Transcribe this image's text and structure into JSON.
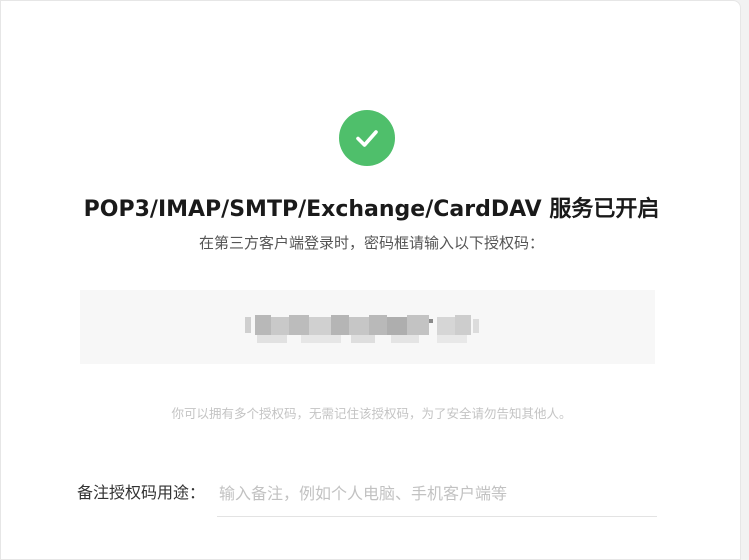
{
  "dialog": {
    "title": "POP3/IMAP/SMTP/Exchange/CardDAV 服务已开启",
    "subtitle": "在第三方客户端登录时，密码框请输入以下授权码：",
    "success_icon": "check-circle-icon",
    "accent_color": "#4fbf6b"
  },
  "auth_code": {
    "display": "obscured"
  },
  "hint": "你可以拥有多个授权码，无需记住该授权码，为了安全请勿告知其他人。",
  "purpose": {
    "label": "备注授权码用途：",
    "placeholder": "输入备注，例如个人电脑、手机客户端等",
    "value": ""
  }
}
